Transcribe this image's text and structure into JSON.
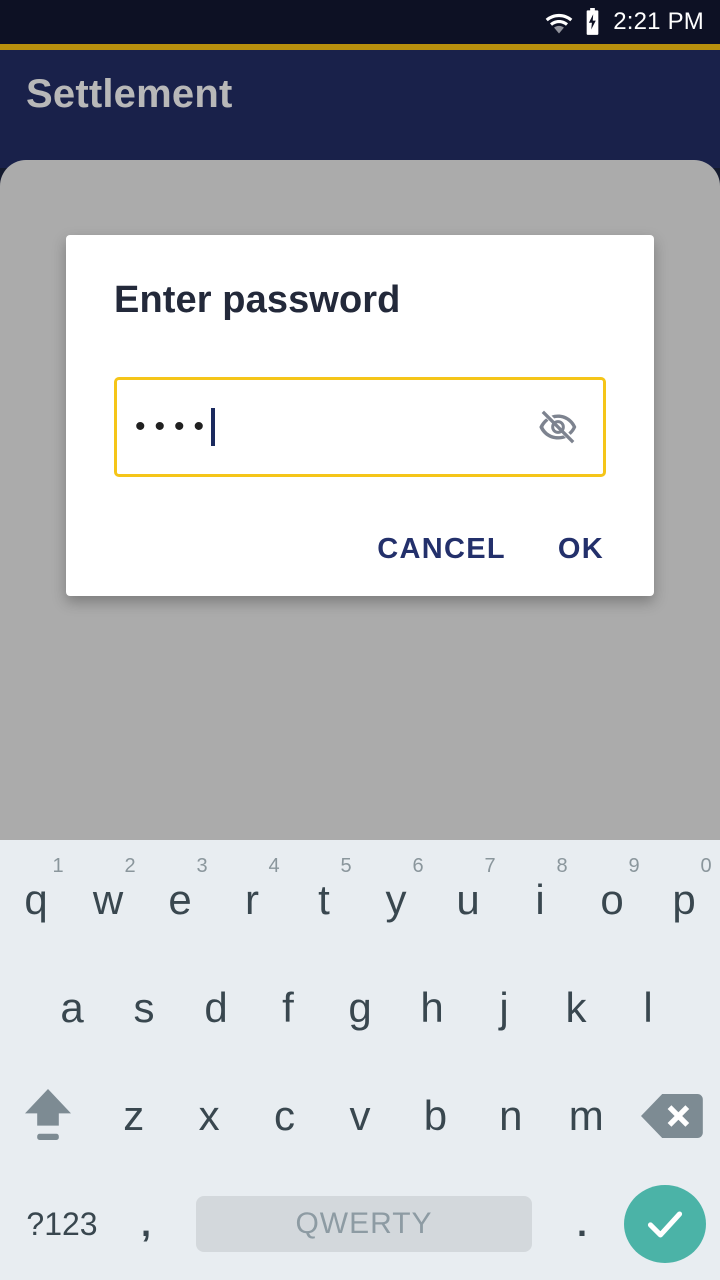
{
  "status_bar": {
    "time": "2:21 PM",
    "wifi_icon": "wifi-icon",
    "battery_icon": "battery-charging-icon",
    "background_color": "#0D1124"
  },
  "accent_bar": {
    "color": "#B8900D"
  },
  "app_bar": {
    "title": "Settlement",
    "background_color": "#19214A",
    "title_color": "#B8B8B8"
  },
  "content": {
    "background_color": "#ABABAB"
  },
  "dialog": {
    "title": "Enter password",
    "password_field": {
      "value": "••••",
      "masked_char_count": 4,
      "placeholder": "",
      "border_color": "#F5C518",
      "caret_color": "#1B2A5E",
      "visibility_toggle_icon": "eye-off-icon",
      "visibility_state": "hidden"
    },
    "buttons": {
      "cancel_label": "CANCEL",
      "ok_label": "OK",
      "color": "#23306B"
    }
  },
  "keyboard": {
    "background_color": "#E8EDF1",
    "row1": [
      {
        "label": "q",
        "hint": "1"
      },
      {
        "label": "w",
        "hint": "2"
      },
      {
        "label": "e",
        "hint": "3"
      },
      {
        "label": "r",
        "hint": "4"
      },
      {
        "label": "t",
        "hint": "5"
      },
      {
        "label": "y",
        "hint": "6"
      },
      {
        "label": "u",
        "hint": "7"
      },
      {
        "label": "i",
        "hint": "8"
      },
      {
        "label": "o",
        "hint": "9"
      },
      {
        "label": "p",
        "hint": "0"
      }
    ],
    "row2": [
      {
        "label": "a"
      },
      {
        "label": "s"
      },
      {
        "label": "d"
      },
      {
        "label": "f"
      },
      {
        "label": "g"
      },
      {
        "label": "h"
      },
      {
        "label": "j"
      },
      {
        "label": "k"
      },
      {
        "label": "l"
      }
    ],
    "row3": {
      "shift_icon": "shift-icon",
      "keys": [
        {
          "label": "z"
        },
        {
          "label": "x"
        },
        {
          "label": "c"
        },
        {
          "label": "v"
        },
        {
          "label": "b"
        },
        {
          "label": "n"
        },
        {
          "label": "m"
        }
      ],
      "backspace_icon": "backspace-icon"
    },
    "row4": {
      "symbols_label": "?123",
      "comma_label": ",",
      "space_label": "QWERTY",
      "period_label": ".",
      "enter_icon": "check-icon",
      "enter_color": "#4BB3A7"
    }
  }
}
